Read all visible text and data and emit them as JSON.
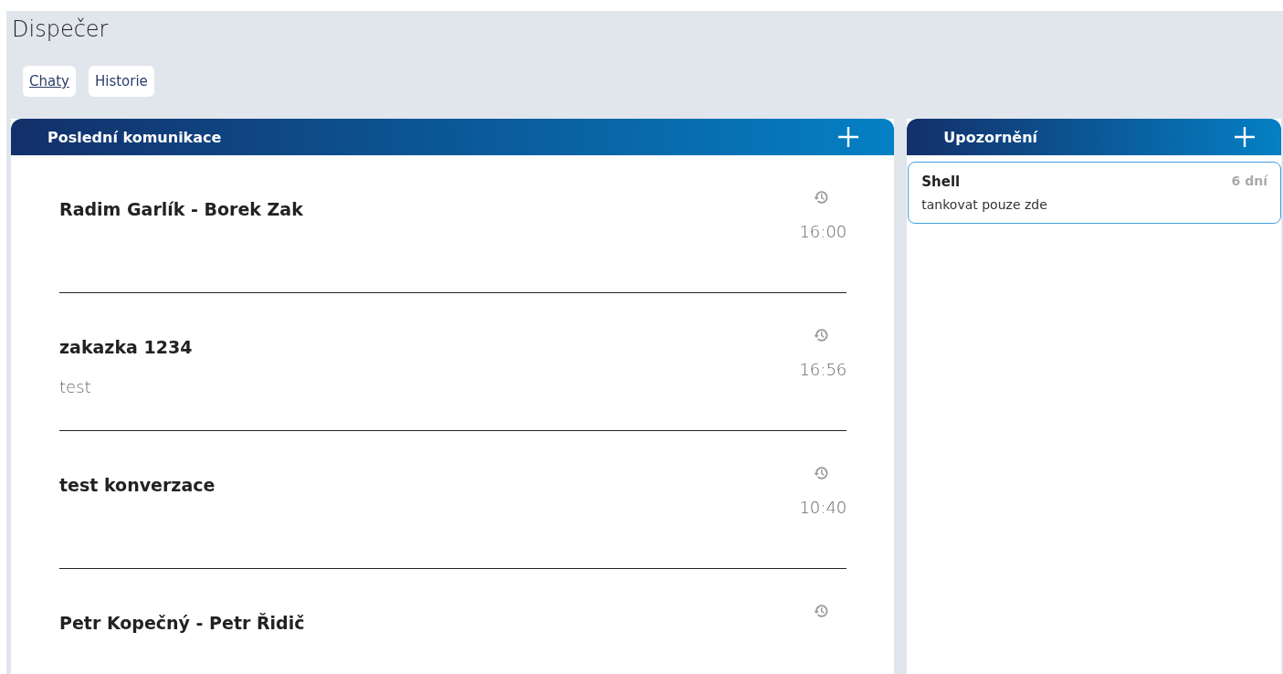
{
  "page_title": "Dispečer",
  "tabs": [
    {
      "label": "Chaty",
      "selected": true
    },
    {
      "label": "Historie",
      "selected": false
    }
  ],
  "conversations": {
    "title": "Poslední komunikace",
    "items": [
      {
        "title": "Radim Garlík - Borek Zak",
        "time": "16:00"
      },
      {
        "title": "zakazka 1234",
        "preview": "test",
        "time": "16:56"
      },
      {
        "title": "test konverzace",
        "time": "10:40"
      },
      {
        "title": "Petr Kopečný - Petr Řidič"
      }
    ]
  },
  "notices": {
    "title": "Upozornění",
    "items": [
      {
        "title": "Shell",
        "age": "6 dní",
        "text": "tankovat pouze zde"
      }
    ]
  }
}
